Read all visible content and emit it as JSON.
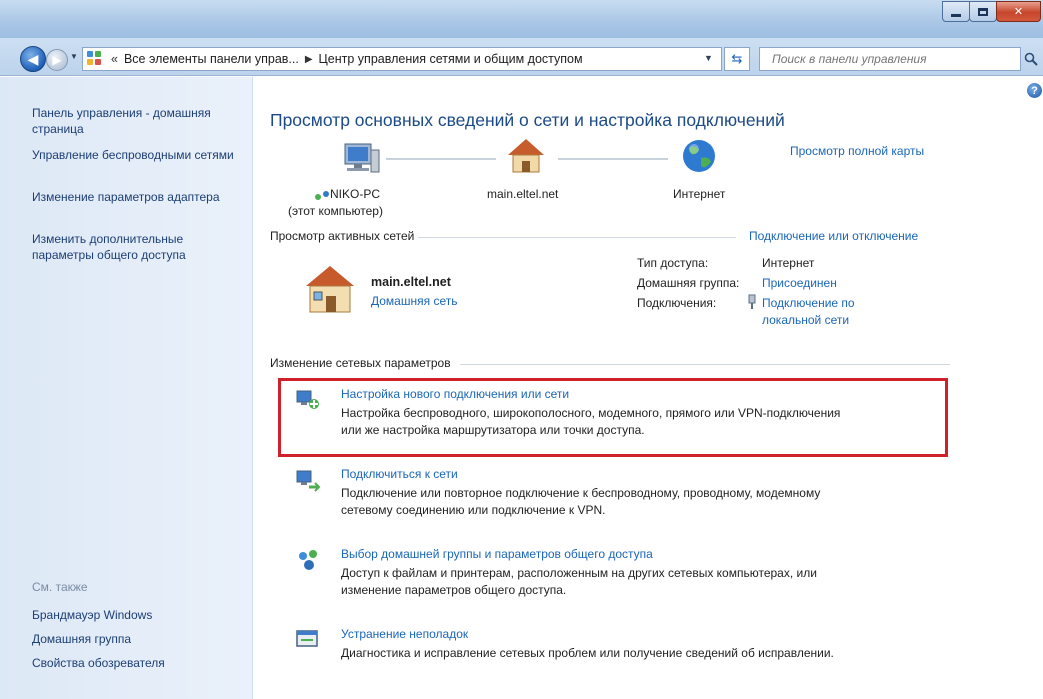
{
  "window": {
    "min_glyph": "—",
    "max_glyph": "□",
    "close_glyph": "✕"
  },
  "address": {
    "chevron": "«",
    "crumb1": "Все элементы панели управ...",
    "sep": "▶",
    "crumb2": "Центр управления сетями и общим доступом",
    "search_placeholder": "Поиск в панели управления"
  },
  "sidebar": {
    "items": [
      {
        "label": "Панель управления - домашняя страница"
      },
      {
        "label": "Управление беспроводными сетями"
      },
      {
        "label": "Изменение параметров адаптера"
      },
      {
        "label": "Изменить дополнительные параметры общего доступа"
      }
    ],
    "see_also": "См. также",
    "also_items": [
      {
        "label": "Брандмауэр Windows"
      },
      {
        "label": "Домашняя группа"
      },
      {
        "label": "Свойства обозревателя"
      }
    ]
  },
  "main": {
    "title": "Просмотр основных сведений о сети и настройка подключений",
    "full_map_link": "Просмотр полной карты",
    "nodes": {
      "pc": "NIKO-PC",
      "pc_sub": "(этот компьютер)",
      "router": "main.eltel.net",
      "internet": "Интернет"
    },
    "active": {
      "heading": "Просмотр активных сетей",
      "connect_link": "Подключение или отключение",
      "network_name": "main.eltel.net",
      "network_type": "Домашняя сеть",
      "access_type_label": "Тип доступа:",
      "access_type_value": "Интернет",
      "homegroup_label": "Домашняя группа:",
      "homegroup_value": "Присоединен",
      "connections_label": "Подключения:",
      "connections_value_1": "Подключение по",
      "connections_value_2": "локальной сети"
    },
    "change": {
      "heading": "Изменение сетевых параметров",
      "tasks": [
        {
          "title": "Настройка нового подключения или сети",
          "desc1": "Настройка беспроводного, широкополосного, модемного, прямого или VPN-подключения",
          "desc2": "или же настройка маршрутизатора или точки доступа."
        },
        {
          "title": "Подключиться к сети",
          "desc1": "Подключение или повторное подключение к беспроводному, проводному, модемному",
          "desc2": "сетевому соединению или подключение к VPN."
        },
        {
          "title": "Выбор домашней группы и параметров общего доступа",
          "desc1": "Доступ к файлам и принтерам, расположенным на других сетевых компьютерах, или",
          "desc2": "изменение параметров общего доступа."
        },
        {
          "title": "Устранение неполадок",
          "desc1": "Диагностика и исправление сетевых проблем или получение сведений об исправлении."
        }
      ]
    }
  },
  "colors": {
    "link": "#1a66b8",
    "title": "#1c4a86",
    "highlight": "#d0202a"
  }
}
